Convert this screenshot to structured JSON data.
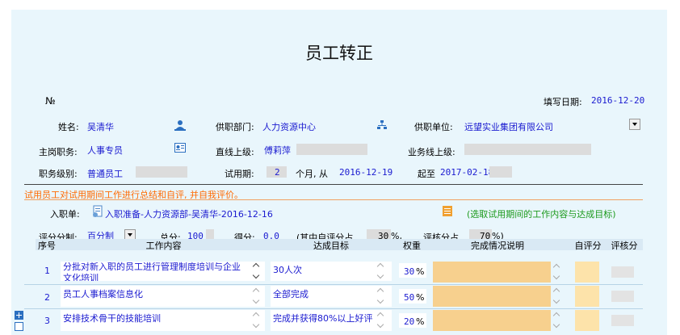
{
  "title": "员工转正",
  "header": {
    "no_label": "№",
    "fill_date_label": "填写日期:",
    "fill_date": "2016-12-20"
  },
  "fields": {
    "name_label": "姓名:",
    "name": "吴清华",
    "dept_label": "供职部门:",
    "dept": "人力资源中心",
    "unit_label": "供职单位:",
    "unit": "远望实业集团有限公司",
    "main_position_label": "主岗职务:",
    "main_position": "人事专员",
    "supervisor_label": "直线上级:",
    "supervisor": "傅莉萍",
    "business_supervisor_label": "业务线上级:",
    "rank_label": "职务级别:",
    "rank": "普通员工",
    "probation_label": "试用期:",
    "probation_months": "2",
    "probation_from": "个月, 从",
    "start_date": "2016-12-19",
    "end_label": "起至",
    "end_date": "2017-02-18"
  },
  "hint_text": "试用员工对试用期间工作进行总结和自评, 并自我评价。",
  "entry": {
    "label": "入职单:",
    "link": "入职准备-人力资源部-吴清华-2016-12-16",
    "hint": "(选取试用期间的工作内容与达成目标)"
  },
  "scoring": {
    "system_label": "评分分制:",
    "system": "百分制",
    "total_label": "总分:",
    "total": "100",
    "score_label": "得分:",
    "score": "0.0",
    "self_label": "(其中自评分占",
    "self_pct": "30",
    "self_unit": "%,",
    "review_label": "评核分占",
    "review_pct": "70",
    "review_unit": "%)"
  },
  "table": {
    "headers": [
      "序号",
      "工作内容",
      "达成目标",
      "权重",
      "完成情况说明",
      "自评分",
      "评核分"
    ],
    "rows": [
      {
        "no": "1",
        "content": "分批对新入职的员工进行管理制度培训与企业文化培训",
        "target": "30人次",
        "weight": "30",
        "unit": "%"
      },
      {
        "no": "2",
        "content": "员工人事档案信息化",
        "target": "全部完成",
        "weight": "50",
        "unit": "%"
      },
      {
        "no": "3",
        "content": "安排技术骨干的技能培训",
        "target": "完成并获得80%以上好评",
        "weight": "20",
        "unit": "%"
      }
    ]
  },
  "icons": {
    "person": "person-icon",
    "org": "org-chart-icon",
    "card": "id-card-icon",
    "doc": "document-icon",
    "picker": "picker-icon",
    "add": "add-row-icon"
  },
  "colors": {
    "panel": "#e9f6fc",
    "value_blue": "#1a1ad0",
    "hint_orange": "#ff6a00",
    "hint_green": "#1c9a1c",
    "peach": "#f7d08e"
  }
}
